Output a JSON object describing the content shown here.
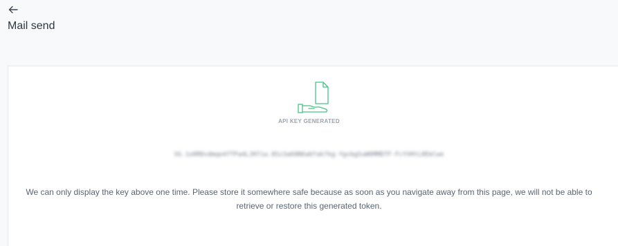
{
  "header": {
    "back_icon": "arrow-left-icon",
    "title": "Mail send"
  },
  "card": {
    "icon": "hand-holding-document-icon",
    "icon_color": "#46c285",
    "status_label": "API KEY GENERATED",
    "api_key": "SG.1o0RDvdmqe4fTPa4LJH7iw.8Sz3a60N6a6fak7kg-YgvbgSuW0MMDTF-FcYVHtL8Emlwe",
    "notice": "We can only display the key above one time. Please store it somewhere safe because as soon as you navigate away from this page, we will not be able to retrieve or restore this generated token."
  }
}
